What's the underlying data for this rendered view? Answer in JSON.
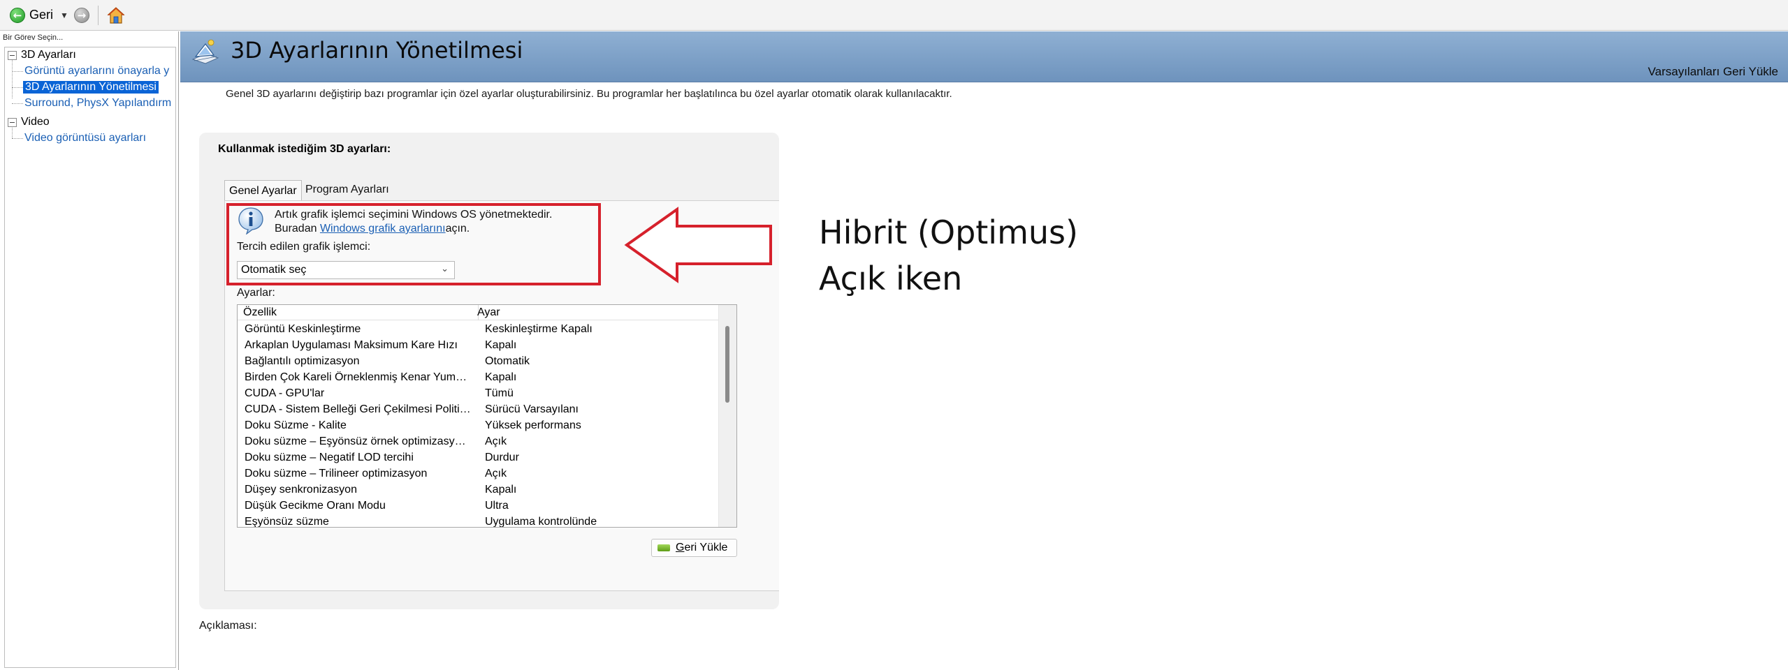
{
  "toolbar": {
    "back_label": "Geri",
    "back_icon": "back-arrow-icon",
    "forward_icon": "forward-arrow-icon",
    "home_icon": "home-icon"
  },
  "left_pane": {
    "caption": "Bir Görev Seçin...",
    "tree": [
      {
        "label": "3D Ayarları",
        "expander": "−",
        "children": [
          {
            "label": "Görüntü ayarlarını önayarla y"
          },
          {
            "label": "3D Ayarlarının Yönetilmesi",
            "selected": true
          },
          {
            "label": "Surround, PhysX Yapılandırm"
          }
        ]
      },
      {
        "label": "Video",
        "expander": "−",
        "children": [
          {
            "label": "Video görüntüsü ayarları"
          }
        ]
      }
    ]
  },
  "header": {
    "title": "3D Ayarlarının Yönetilmesi",
    "restore_defaults": "Varsayılanları Geri Yükle"
  },
  "content": {
    "intro": "Genel 3D ayarlarını değiştirip bazı programlar için özel ayarlar oluşturabilirsiniz. Bu programlar her başlatılınca bu özel ayarlar otomatik olarak kullanılacaktır.",
    "group_heading": "Kullanmak istediğim 3D ayarları:",
    "tabs": [
      {
        "label": "Genel Ayarlar",
        "active": true
      },
      {
        "label": "Program Ayarları",
        "active": false
      }
    ],
    "info_line1": "Artık grafik işlemci seçimini Windows OS yönetmektedir.",
    "info_line2_prefix": "Buradan ",
    "info_link": "Windows grafik ayarlarını",
    "info_line2_suffix": "açın.",
    "preferred_gpu_label": "Tercih edilen grafik işlemci:",
    "preferred_gpu_value": "Otomatik seç",
    "settings_label": "Ayarlar:",
    "columns": [
      "Özellik",
      "Ayar"
    ],
    "rows": [
      [
        "Görüntü Keskinleştirme",
        "Keskinleştirme Kapalı"
      ],
      [
        "Arkaplan Uygulaması Maksimum Kare Hızı",
        "Kapalı"
      ],
      [
        "Bağlantılı optimizasyon",
        "Otomatik"
      ],
      [
        "Birden Çok Kareli Örneklenmiş Kenar Yumuşatma",
        "Kapalı"
      ],
      [
        "CUDA - GPU'lar",
        "Tümü"
      ],
      [
        "CUDA - Sistem Belleği Geri Çekilmesi Politikası",
        "Sürücü Varsayılanı"
      ],
      [
        "Doku Süzme - Kalite",
        "Yüksek performans"
      ],
      [
        "Doku süzme – Eşyönsüz örnek optimizasyonu",
        "Açık"
      ],
      [
        "Doku süzme – Negatif LOD tercihi",
        "Durdur"
      ],
      [
        "Doku süzme – Trilineer optimizasyon",
        "Açık"
      ],
      [
        "Düşey senkronizasyon",
        "Kapalı"
      ],
      [
        "Düşük Gecikme Oranı Modu",
        "Ultra"
      ],
      [
        "Eşyönsüz süzme",
        "Uygulama kontrolünde"
      ]
    ],
    "restore_button_hotkey": "G",
    "restore_button_rest": "eri Yükle",
    "description_label": "Açıklaması:"
  },
  "annotation": {
    "line1": "Hibrit (Optimus)",
    "line2": "Açık iken",
    "color": "#d6212c"
  }
}
